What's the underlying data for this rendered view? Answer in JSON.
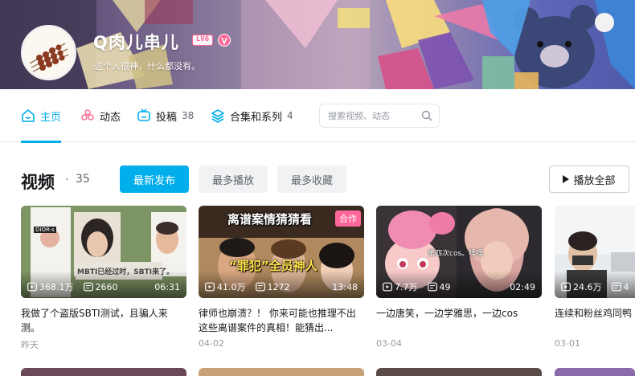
{
  "colors": {
    "accent": "#00aeec",
    "pink": "#ff6699",
    "text_secondary": "#61666d",
    "text_muted": "#9499a0"
  },
  "profile": {
    "name": "Q肉儿串儿",
    "level_badge": "LV6",
    "bio": "这个人很神，什么都没有。",
    "vip_icon": "vip-icon"
  },
  "nav": {
    "tabs": [
      {
        "label": "主页",
        "icon": "home-icon",
        "count": ""
      },
      {
        "label": "动态",
        "icon": "activity-icon",
        "count": ""
      },
      {
        "label": "投稿",
        "icon": "tv-icon",
        "count": "38"
      },
      {
        "label": "合集和系列",
        "icon": "layers-icon",
        "count": "4"
      }
    ],
    "search_placeholder": "搜索视频、动态"
  },
  "section": {
    "title": "视频",
    "dot": "·",
    "count": "35",
    "sort_options": [
      "最新发布",
      "最多播放",
      "最多收藏"
    ],
    "play_all": "播放全部"
  },
  "videos": [
    {
      "views": "368.1万",
      "danmaku": "2660",
      "duration": "06:31",
      "title": "我做了个盗版SBTI测试，且骗人来测。",
      "date": "昨天",
      "thumb_text": [
        "MBTI已经过时，SBTI来了。",
        "DIOR-s"
      ]
    },
    {
      "views": "41.0万",
      "danmaku": "1272",
      "duration": "13:48",
      "title": "律师也崩溃？！ 你来可能也推理不出这些离谱案件的真相！能猜出...",
      "date": "04-02",
      "thumb_text": [
        "离谱案情猜猜看",
        "“罪犯”全员神人"
      ],
      "tag": "合作"
    },
    {
      "views": "7.7万",
      "danmaku": "49",
      "duration": "02:49",
      "title": "一边唐笑，一边学雅思，一边cos",
      "date": "03-04",
      "thumb_text": [
        "第四次cos。嘿嘿"
      ]
    },
    {
      "views": "24.6万",
      "danmaku": "4",
      "title": "连续和粉丝鸡同鸭",
      "date": "03-01"
    }
  ]
}
